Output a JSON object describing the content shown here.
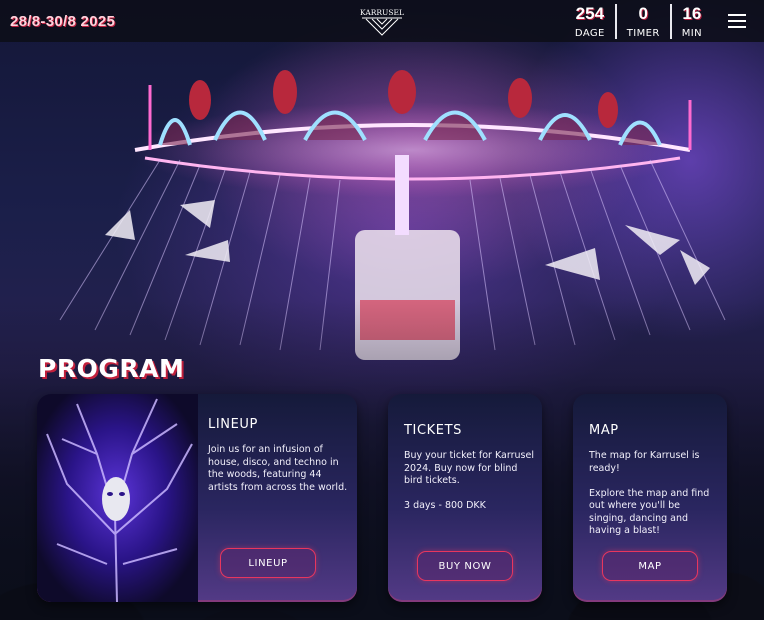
{
  "header": {
    "dates": "28/8-30/8 2025",
    "logo_text": "KARRUSEL",
    "countdown": [
      {
        "value": "254",
        "label": "DAGE"
      },
      {
        "value": "0",
        "label": "TIMER"
      },
      {
        "value": "16",
        "label": "MIN"
      }
    ]
  },
  "program": {
    "title": "PROGRAM",
    "cards": [
      {
        "title": "LINEUP",
        "text": "Join us for an infusion of house, disco, and techno in the woods, featuring 44 artists from across the world.",
        "button": "LINEUP"
      },
      {
        "title": "TICKETS",
        "text": "Buy your ticket for Karrusel 2024. Buy now for blind bird tickets.\n\n3 days - 800 DKK",
        "button": "BUY NOW"
      },
      {
        "title": "MAP",
        "text": "The map for Karrusel is ready!\n\nExplore the map and find out where you'll be singing, dancing and having a blast!",
        "button": "MAP"
      }
    ]
  },
  "colors": {
    "accent": "#e8365e",
    "card_top": "#151a3a",
    "card_bottom": "#533a86"
  }
}
